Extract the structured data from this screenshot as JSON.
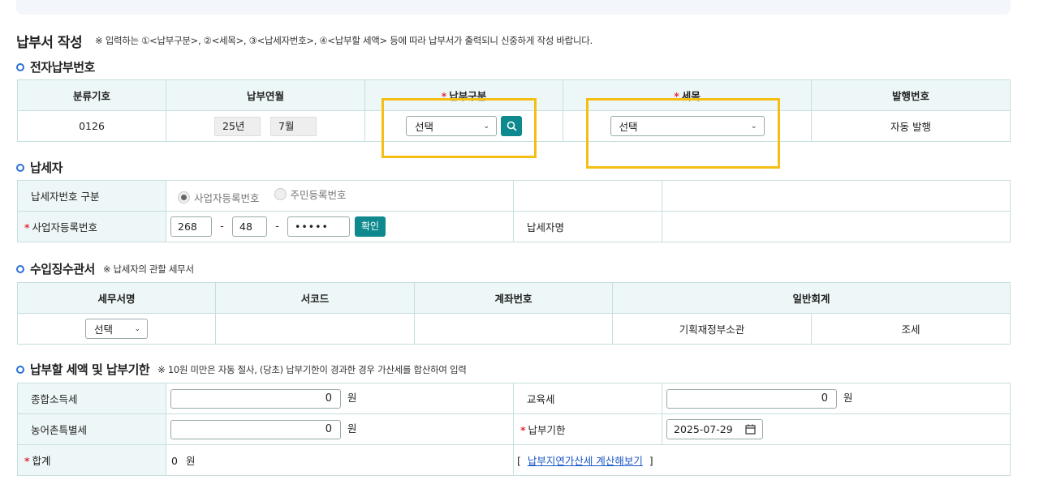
{
  "title": "납부서 작성",
  "title_note": "※ 입력하는 ①<납부구분>, ②<세목>, ③<납세자번호>, ④<납부할 세액> 등에 따라 납부서가 출력되니 신중하게 작성 바랍니다.",
  "required_mark": "*",
  "section1": {
    "title": "전자납부번호",
    "headers": [
      "분류기호",
      "납부연월",
      "납부구분",
      "세목",
      "발행번호"
    ],
    "class_code": "0126",
    "year": "25년",
    "month": "7월",
    "payment_type": "선택",
    "tax_item": "선택",
    "issue_no": "자동 발행"
  },
  "section2": {
    "title": "납세자",
    "id_type_label": "납세자번호 구분",
    "radio_business": "사업자등록번호",
    "radio_resident": "주민등록번호",
    "brn_label": "사업자등록번호",
    "brn1": "268",
    "brn2": "48",
    "brn3": "•••••",
    "dash": "-",
    "confirm": "확인",
    "name_label": "납세자명"
  },
  "section3": {
    "title": "수입징수관서",
    "note": "※ 납세자의 관할 세무서",
    "headers": [
      "세무서명",
      "서코드",
      "계좌번호",
      "일반회계"
    ],
    "office_select": "선택",
    "ministry": "기획재정부소관",
    "tax": "조세"
  },
  "section4": {
    "title": "납부할 세액 및 납부기한",
    "note": "※ 10원 미만은 자동 절사, (당초) 납부기한이 경과한 경우 가산세를 합산하여 입력",
    "income_tax_label": "종합소득세",
    "income_tax_value": "0",
    "education_tax_label": "교육세",
    "education_tax_value": "0",
    "rural_tax_label": "농어촌특별세",
    "rural_tax_value": "0",
    "due_label": "납부기한",
    "due_value": "2025-07-29",
    "total_label": "합계",
    "total_value": "0",
    "unit": "원",
    "link_prefix": "[",
    "link_text": "납부지연가산세 계산해보기",
    "link_suffix": "]"
  },
  "colors": {
    "accent": "#0e8a8f",
    "highlight": "#f5be14",
    "required": "#e0303d",
    "bullet": "#2b6fd6"
  }
}
